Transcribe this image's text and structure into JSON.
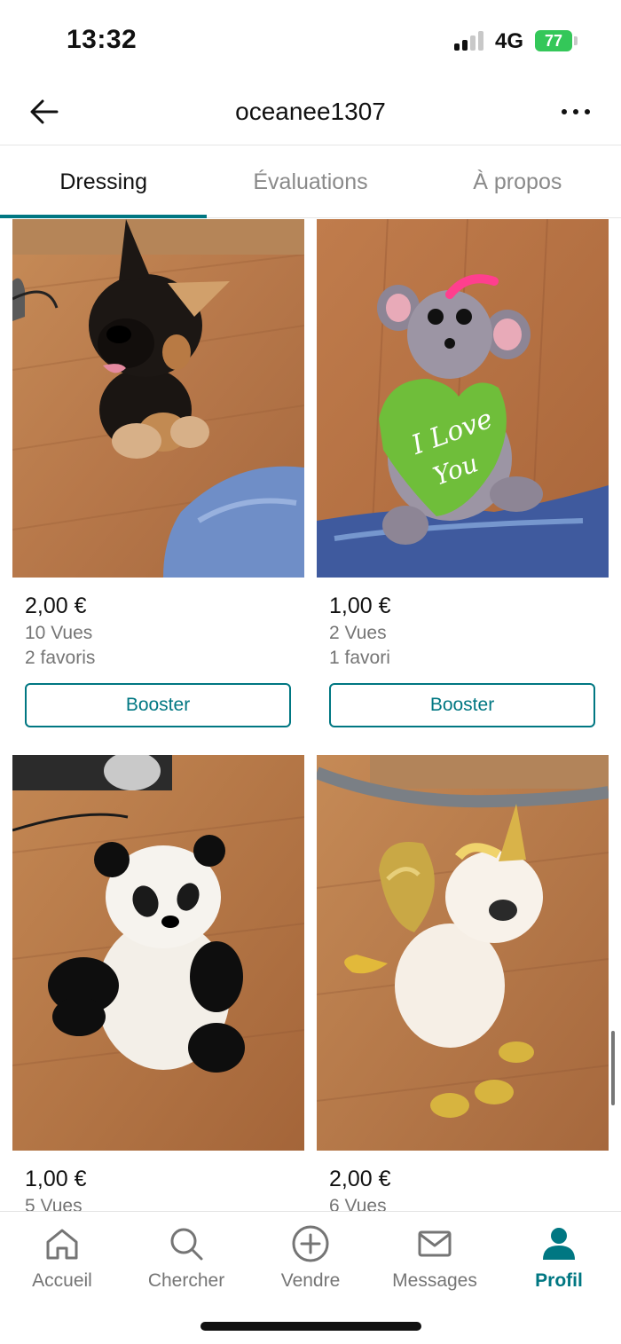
{
  "status_bar": {
    "time": "13:32",
    "network": "4G",
    "battery": "77"
  },
  "header": {
    "title": "oceanee1307"
  },
  "tabs": [
    {
      "label": "Dressing",
      "active": true
    },
    {
      "label": "Évaluations",
      "active": false
    },
    {
      "label": "À propos",
      "active": false
    }
  ],
  "items": [
    {
      "price": "2,00 €",
      "views": "10 Vues",
      "favorites": "2 favoris",
      "button": "Booster",
      "photo": "black-tan-dog-plush"
    },
    {
      "price": "1,00 €",
      "views": "2 Vues",
      "favorites": "1 favori",
      "button": "Booster",
      "photo": "grey-mouse-plush-i-love-you-heart"
    },
    {
      "price": "1,00 €",
      "views": "5 Vues",
      "photo": "panda-plush"
    },
    {
      "price": "2,00 €",
      "views": "6 Vues",
      "photo": "unicorn-plush-gold-wings"
    }
  ],
  "photo_text": {
    "heart_line1": "I Love",
    "heart_line2": "You"
  },
  "bottom_nav": [
    {
      "label": "Accueil",
      "icon": "home-icon"
    },
    {
      "label": "Chercher",
      "icon": "search-icon"
    },
    {
      "label": "Vendre",
      "icon": "plus-circle-icon"
    },
    {
      "label": "Messages",
      "icon": "mail-icon"
    },
    {
      "label": "Profil",
      "icon": "profile-icon",
      "active": true
    }
  ],
  "colors": {
    "accent": "#007782",
    "battery": "#34c759"
  }
}
